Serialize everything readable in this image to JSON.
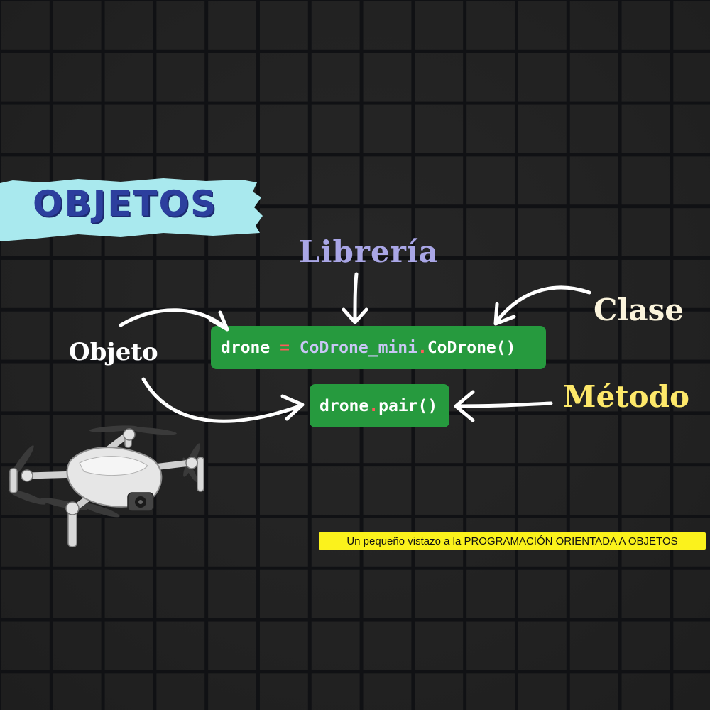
{
  "title": "OBJETOS",
  "labels": {
    "libreria": "Librería",
    "clase": "Clase",
    "objeto": "Objeto",
    "metodo": "Método"
  },
  "code_line_1": {
    "var": "drone",
    "op": " = ",
    "module": "CoDrone_mini",
    "dot": ".",
    "call": "CoDrone()"
  },
  "code_line_2": {
    "var": "drone",
    "dot": ".",
    "call": "pair()"
  },
  "subtitle": "Un pequeño vistazo a la PROGRAMACIÓN ORIENTADA A OBJETOS",
  "colors": {
    "background": "#222222",
    "banner": "#a9e9ee",
    "title": "#2c3f9e",
    "code_box": "#269a3e",
    "libreria": "#a9a6e6",
    "clase": "#fbf4dc",
    "metodo": "#fde86a",
    "subtitle_bg": "#fbf21c"
  },
  "icons": [
    "drone-illustration",
    "arrow-icon"
  ]
}
